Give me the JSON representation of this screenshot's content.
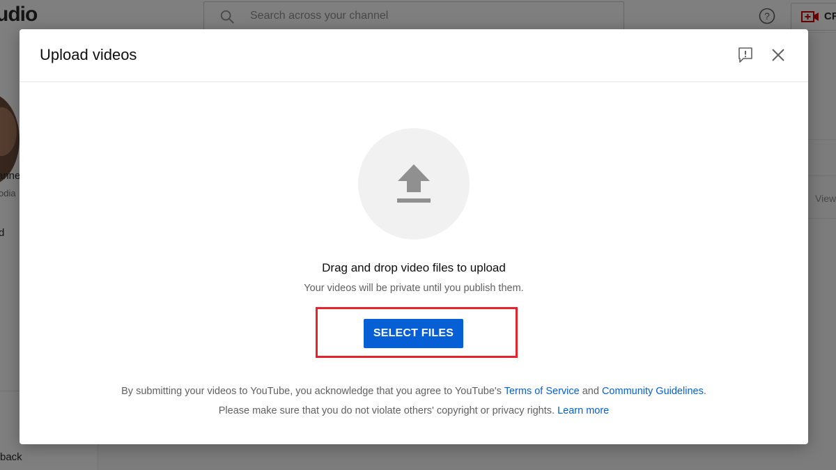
{
  "app": {
    "logo_fragment": "udio",
    "search": {
      "placeholder": "Search across your channel"
    },
    "create_label": "CR",
    "sidebar": {
      "channel_name_fragment": "anne",
      "channel_sub_fragment": "odia",
      "item_fragment_1": "d",
      "item_fragment_2": "back"
    },
    "background_column_fragment": "View"
  },
  "dialog": {
    "title": "Upload videos",
    "drag_text": "Drag and drop video files to upload",
    "private_text": "Your videos will be private until you publish them.",
    "select_button": "SELECT FILES",
    "legal_line1_prefix": "By submitting your videos to YouTube, you acknowledge that you agree to YouTube's ",
    "terms_link": "Terms of Service",
    "legal_and": " and ",
    "guidelines_link": "Community Guidelines",
    "legal_period": ".",
    "legal_line2_prefix": "Please make sure that you do not violate others' copyright or privacy rights. ",
    "learn_more_link": "Learn more"
  },
  "colors": {
    "accent": "#065fd4",
    "highlight": "#e8222b",
    "overlay": "rgba(0,0,0,0.5)"
  },
  "icons": [
    "search-icon",
    "help-icon",
    "create-video-icon",
    "feedback-icon",
    "close-icon",
    "upload-arrow-icon"
  ]
}
